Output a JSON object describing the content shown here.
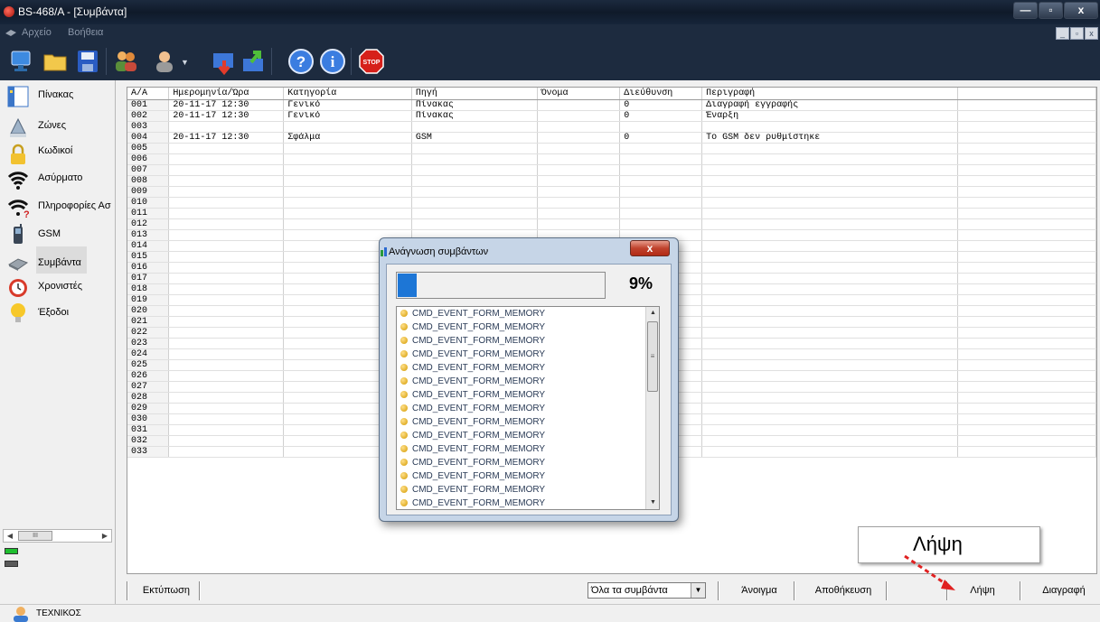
{
  "window": {
    "title": "BS-468/A - [Συμβάντα]",
    "controls": {
      "minimize": "—",
      "maximize": "▫",
      "close": "x"
    }
  },
  "menu": {
    "items": [
      "Αρχείο",
      "Βοήθεια"
    ],
    "mdi_controls": [
      "_",
      "▫",
      "x"
    ]
  },
  "toolbar": {
    "icons": [
      "computer-icon",
      "folder-open-icon",
      "save-icon",
      "users-icon",
      "user-select-icon",
      "download-icon",
      "upload-icon",
      "help-icon",
      "info-icon",
      "stop-icon"
    ],
    "stop_label": "STOP"
  },
  "sidebar": {
    "items": [
      {
        "label": "Πίνακας",
        "icon": "panel-icon"
      },
      {
        "label": "Ζώνες",
        "icon": "zones-icon"
      },
      {
        "label": "Κωδικοί",
        "icon": "lock-icon"
      },
      {
        "label": "Ασύρματο",
        "icon": "wireless-icon"
      },
      {
        "label": "Πληροφορίες Ασ",
        "icon": "wireless-info-icon"
      },
      {
        "label": "GSM",
        "icon": "phone-icon"
      },
      {
        "label": "Συμβάντα",
        "icon": "events-icon"
      },
      {
        "label": "Χρονιστές",
        "icon": "clock-icon"
      },
      {
        "label": "Έξοδοι",
        "icon": "bulb-icon"
      }
    ],
    "active": "Συμβάντα",
    "scroll_thumb": "III",
    "led_colors": [
      "#1fbf2f",
      "#5a5a5a"
    ]
  },
  "table": {
    "columns": [
      "Α/Α",
      "Ημερομηνία/Ώρα",
      "Κατηγορία",
      "Πηγή",
      "Όνομα",
      "Διεύθυνση",
      "Περιγραφή",
      ""
    ],
    "rows": [
      [
        "001",
        "20-11-17    12:30",
        "Γενικό",
        "Πίνακας",
        "",
        "0",
        "Διαγραφή εγγραφής",
        ""
      ],
      [
        "002",
        "20-11-17    12:30",
        "Γενικό",
        "Πίνακας",
        "",
        "0",
        "Έναρξη",
        ""
      ],
      [
        "003",
        "",
        "",
        "",
        "",
        "",
        "",
        ""
      ],
      [
        "004",
        "20-11-17    12:30",
        "Σφάλμα",
        "GSM",
        "",
        "0",
        "Το GSM δεν ρυθμίστηκε",
        ""
      ],
      [
        "005",
        "",
        "",
        "",
        "",
        "",
        "",
        ""
      ],
      [
        "006",
        "",
        "",
        "",
        "",
        "",
        "",
        ""
      ],
      [
        "007",
        "",
        "",
        "",
        "",
        "",
        "",
        ""
      ],
      [
        "008",
        "",
        "",
        "",
        "",
        "",
        "",
        ""
      ],
      [
        "009",
        "",
        "",
        "",
        "",
        "",
        "",
        ""
      ],
      [
        "010",
        "",
        "",
        "",
        "",
        "",
        "",
        ""
      ],
      [
        "011",
        "",
        "",
        "",
        "",
        "",
        "",
        ""
      ],
      [
        "012",
        "",
        "",
        "",
        "",
        "",
        "",
        ""
      ],
      [
        "013",
        "",
        "",
        "",
        "",
        "",
        "",
        ""
      ],
      [
        "014",
        "",
        "",
        "",
        "",
        "",
        "",
        ""
      ],
      [
        "015",
        "",
        "",
        "",
        "",
        "",
        "",
        ""
      ],
      [
        "016",
        "",
        "",
        "",
        "",
        "",
        "",
        ""
      ],
      [
        "017",
        "",
        "",
        "",
        "",
        "",
        "",
        ""
      ],
      [
        "018",
        "",
        "",
        "",
        "",
        "",
        "",
        ""
      ],
      [
        "019",
        "",
        "",
        "",
        "",
        "",
        "",
        ""
      ],
      [
        "020",
        "",
        "",
        "",
        "",
        "",
        "",
        ""
      ],
      [
        "021",
        "",
        "",
        "",
        "",
        "",
        "",
        ""
      ],
      [
        "022",
        "",
        "",
        "",
        "",
        "",
        "",
        ""
      ],
      [
        "023",
        "",
        "",
        "",
        "",
        "",
        "",
        ""
      ],
      [
        "024",
        "",
        "",
        "",
        "",
        "",
        "",
        ""
      ],
      [
        "025",
        "",
        "",
        "",
        "",
        "",
        "",
        ""
      ],
      [
        "026",
        "",
        "",
        "",
        "",
        "",
        "",
        ""
      ],
      [
        "027",
        "",
        "",
        "",
        "",
        "",
        "",
        ""
      ],
      [
        "028",
        "",
        "",
        "",
        "",
        "",
        "",
        ""
      ],
      [
        "029",
        "",
        "",
        "",
        "",
        "",
        "",
        ""
      ],
      [
        "030",
        "",
        "",
        "",
        "",
        "",
        "",
        ""
      ],
      [
        "031",
        "",
        "",
        "",
        "",
        "",
        "",
        ""
      ],
      [
        "032",
        "",
        "",
        "",
        "",
        "",
        "",
        ""
      ],
      [
        "033",
        "",
        "",
        "",
        "",
        "",
        "",
        ""
      ]
    ]
  },
  "bottom": {
    "print_label": "Εκτύπωση",
    "filter_value": "Όλα τα συμβάντα",
    "open_label": "Άνοιγμα",
    "save_label": "Αποθήκευση",
    "download_label": "Λήψη",
    "delete_label": "Διαγραφή"
  },
  "status": {
    "user": "ΤΕΧΝΙΚΟΣ"
  },
  "dialog": {
    "title": "Ανάγνωση συμβάντων",
    "close": "x",
    "progress_percent": 9,
    "progress_label": "9%",
    "items": [
      "CMD_EVENT_FORM_MEMORY",
      "CMD_EVENT_FORM_MEMORY",
      "CMD_EVENT_FORM_MEMORY",
      "CMD_EVENT_FORM_MEMORY",
      "CMD_EVENT_FORM_MEMORY",
      "CMD_EVENT_FORM_MEMORY",
      "CMD_EVENT_FORM_MEMORY",
      "CMD_EVENT_FORM_MEMORY",
      "CMD_EVENT_FORM_MEMORY",
      "CMD_EVENT_FORM_MEMORY",
      "CMD_EVENT_FORM_MEMORY",
      "CMD_EVENT_FORM_MEMORY",
      "CMD_EVENT_FORM_MEMORY",
      "CMD_EVENT_FORM_MEMORY",
      "CMD_EVENT_FORM_MEMORY"
    ],
    "scroll_grip": "≡"
  },
  "callout": {
    "text": "Λήψη"
  },
  "colors": {
    "titlebar": "#0f1a2a",
    "progress": "#1d76d6",
    "arrow": "#e02020"
  }
}
